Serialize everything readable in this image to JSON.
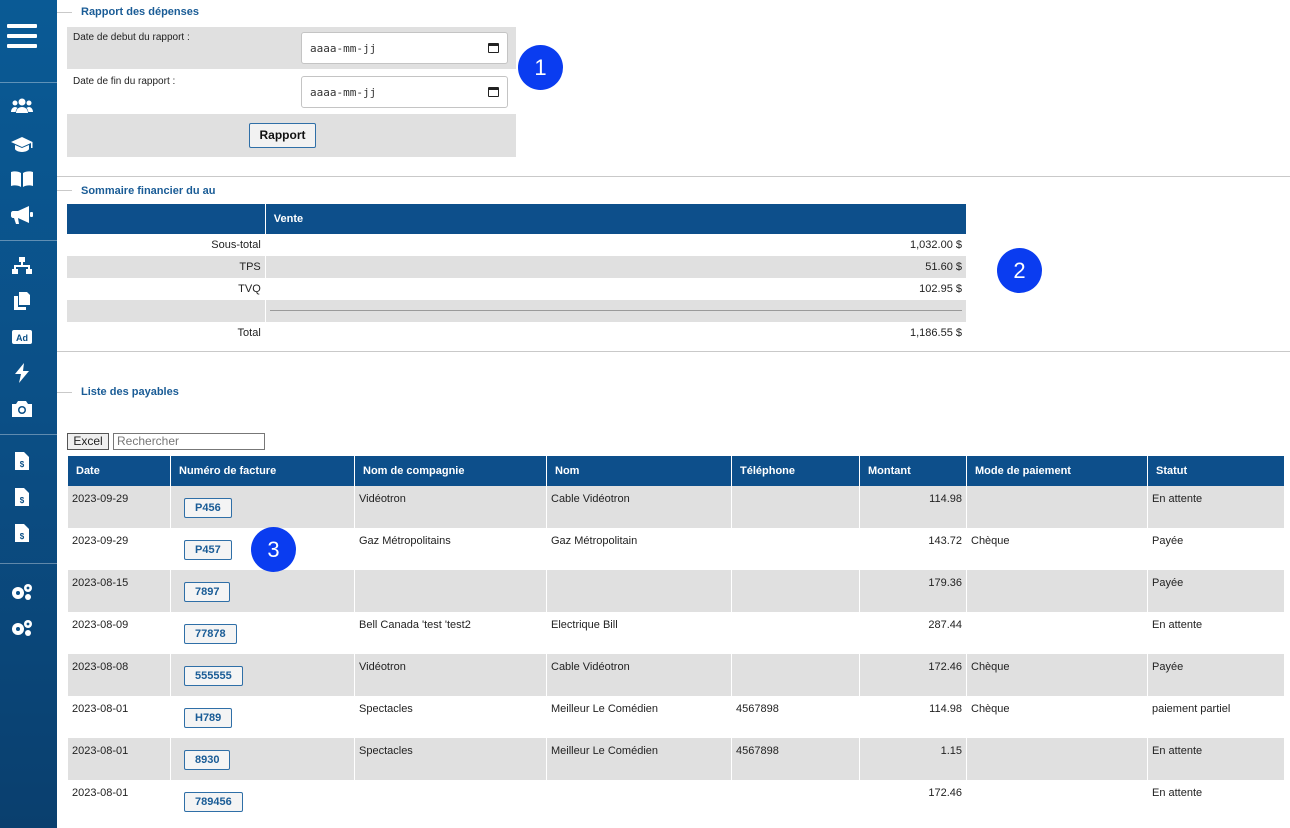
{
  "sidebar": {
    "icons": [
      "menu-icon",
      "users-icon",
      "graduation-cap-icon",
      "book-icon",
      "bullhorn-icon",
      "sitemap-icon",
      "copy-icon",
      "ad-icon",
      "bolt-icon",
      "camera-icon",
      "file-invoice-dollar-icon",
      "file-invoice-dollar-icon",
      "file-invoice-dollar-icon",
      "cogs-icon",
      "cogs-icon"
    ]
  },
  "report": {
    "title": "Rapport des dépenses",
    "start_label": "Date de debut du rapport :",
    "end_label": "Date de fin du rapport :",
    "date_placeholder": "aaaa-mm-jj",
    "button_label": "Rapport"
  },
  "summary": {
    "title": "Sommaire financier du au",
    "column_header": "Vente",
    "rows": [
      {
        "label": "Sous-total",
        "value": "1,032.00 $"
      },
      {
        "label": "TPS",
        "value": "51.60 $"
      },
      {
        "label": "TVQ",
        "value": "102.95 $"
      },
      {
        "label": "",
        "value": ""
      },
      {
        "label": "Total",
        "value": "1,186.55 $"
      }
    ]
  },
  "payables": {
    "title": "Liste des payables",
    "excel_label": "Excel",
    "search_placeholder": "Rechercher",
    "columns": [
      "Date",
      "Numéro de facture",
      "Nom de compagnie",
      "Nom",
      "Téléphone",
      "Montant",
      "Mode de paiement",
      "Statut"
    ],
    "rows": [
      {
        "date": "2023-09-29",
        "invoice": "P456",
        "company": "Vidéotron",
        "name": "Cable Vidéotron",
        "phone": "",
        "amount": "114.98",
        "payment": "",
        "status": "En attente"
      },
      {
        "date": "2023-09-29",
        "invoice": "P457",
        "company": "Gaz Métropolitains",
        "name": "Gaz Métropolitain",
        "phone": "",
        "amount": "143.72",
        "payment": "Chèque",
        "status": "Payée"
      },
      {
        "date": "2023-08-15",
        "invoice": "7897",
        "company": "",
        "name": "",
        "phone": "",
        "amount": "179.36",
        "payment": "",
        "status": "Payée"
      },
      {
        "date": "2023-08-09",
        "invoice": "77878",
        "company": "Bell Canada 'test 'test2",
        "name": "Electrique Bill",
        "phone": "",
        "amount": "287.44",
        "payment": "",
        "status": "En attente"
      },
      {
        "date": "2023-08-08",
        "invoice": "555555",
        "company": "Vidéotron",
        "name": "Cable Vidéotron",
        "phone": "",
        "amount": "172.46",
        "payment": "Chèque",
        "status": "Payée"
      },
      {
        "date": "2023-08-01",
        "invoice": "H789",
        "company": "Spectacles",
        "name": "Meilleur Le Comédien",
        "phone": "4567898",
        "amount": "114.98",
        "payment": "Chèque",
        "status": "paiement partiel"
      },
      {
        "date": "2023-08-01",
        "invoice": "8930",
        "company": "Spectacles",
        "name": "Meilleur Le Comédien",
        "phone": "4567898",
        "amount": "1.15",
        "payment": "",
        "status": "En attente"
      },
      {
        "date": "2023-08-01",
        "invoice": "789456",
        "company": "",
        "name": "",
        "phone": "",
        "amount": "172.46",
        "payment": "",
        "status": "En attente"
      }
    ]
  },
  "steps": [
    "1",
    "2",
    "3"
  ],
  "colors": {
    "sidebar": "#0b4f86",
    "header": "#0d4f8b",
    "step": "#0a3cf0",
    "stripe": "#e0e0e0",
    "accent": "#1a5c96"
  }
}
